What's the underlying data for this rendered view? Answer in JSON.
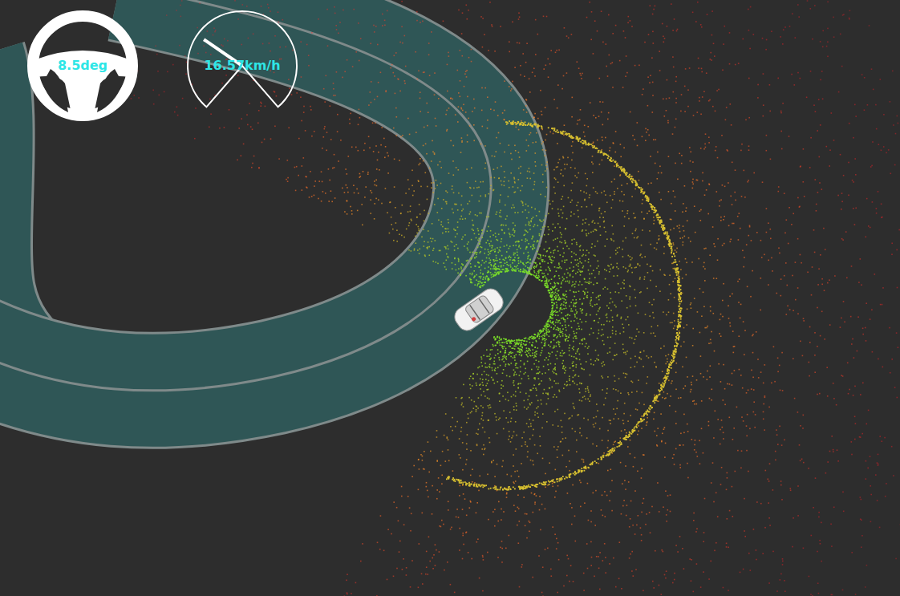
{
  "steering": {
    "reading": "8.5deg"
  },
  "speedometer": {
    "reading": "16.57km/h",
    "level": 0.3
  }
}
